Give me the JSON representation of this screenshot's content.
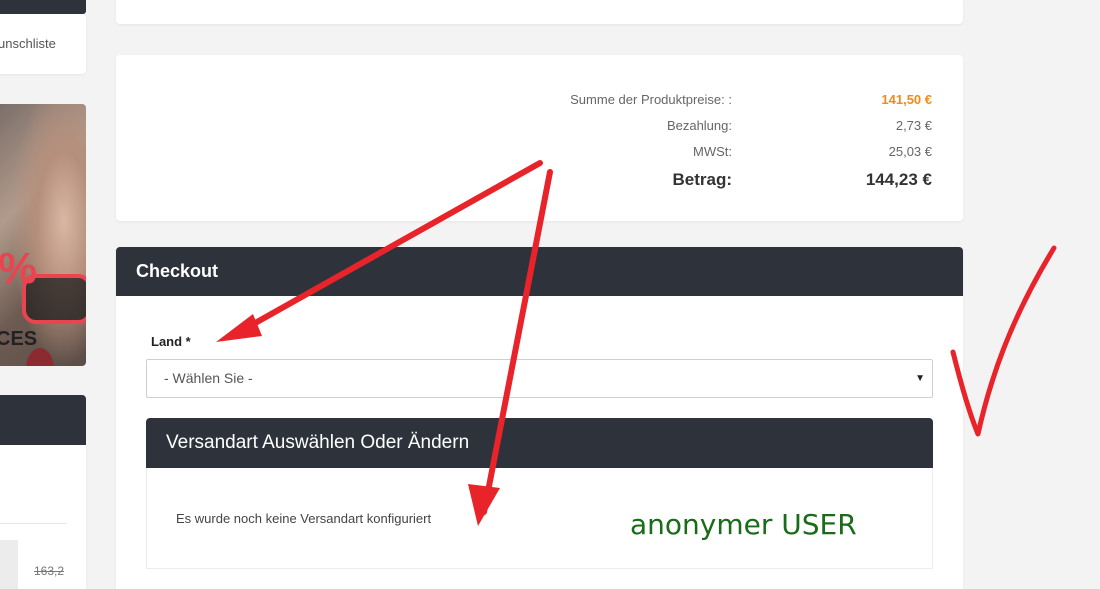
{
  "sidebar": {
    "wishlist_label": "unschliste",
    "banner": {
      "percent_text": "%",
      "caption_text": "CES",
      "button_text": "!"
    },
    "product_old_price": "163,2"
  },
  "totals": {
    "rows": [
      {
        "label": "Summe der Produktpreise: :",
        "value": "141,50 €"
      },
      {
        "label": "Bezahlung:",
        "value": "2,73 €"
      },
      {
        "label": "MWSt:",
        "value": "25,03 €"
      },
      {
        "label": "Betrag:",
        "value": "144,23 €"
      }
    ]
  },
  "checkout": {
    "title": "Checkout",
    "country_label": "Land *",
    "country_selected": "- Wählen Sie -",
    "shipping_title": "Versandart Auswählen Oder Ändern",
    "shipping_message": "Es wurde noch keine Versandart konfiguriert"
  },
  "annotations": {
    "note": "anonymer USER",
    "arrow_color": "#e8232a",
    "checkmark_color": "#e8232a",
    "note_color": "#1a6b1a"
  },
  "colors": {
    "header_dark": "#2e333b",
    "accent_orange": "#f28a1a",
    "accent_red": "#e9444f"
  }
}
